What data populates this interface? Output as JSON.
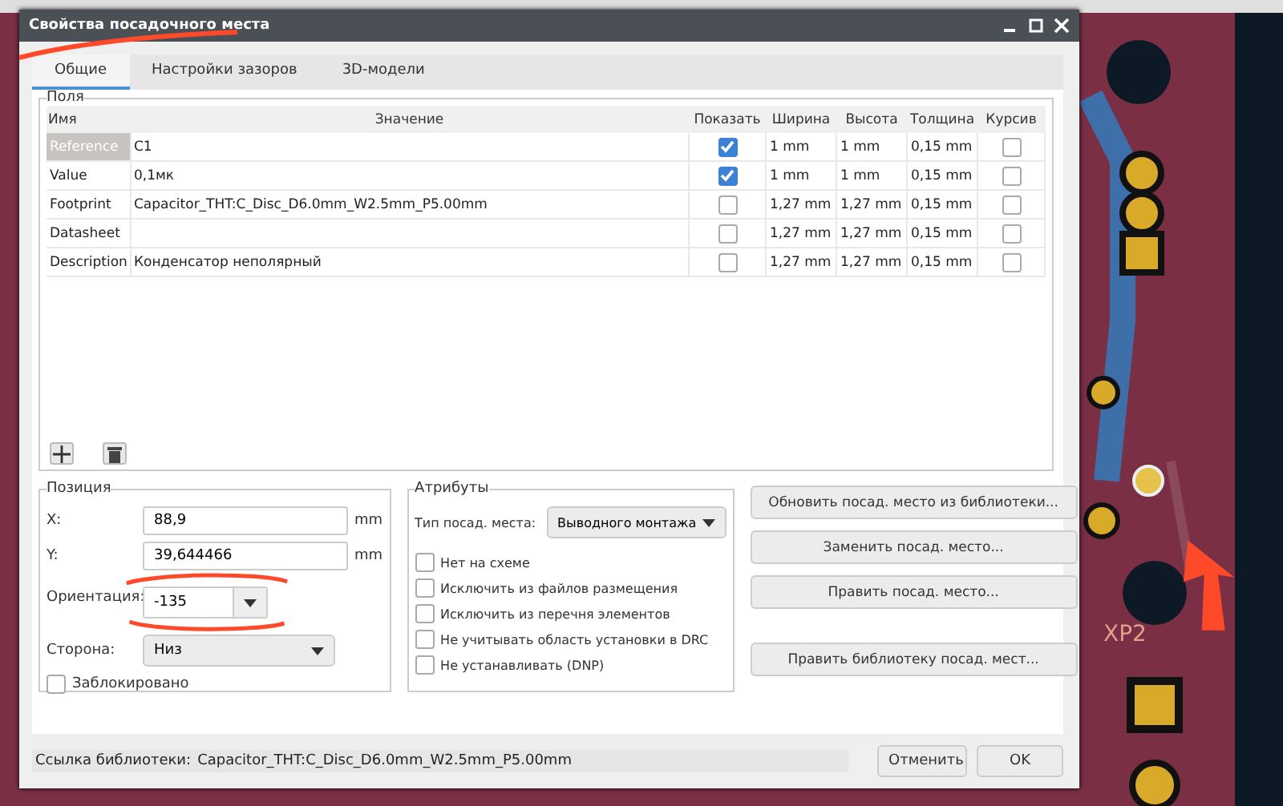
{
  "window": {
    "title": "Свойства посадочного места"
  },
  "tabs": [
    {
      "label": "Общие",
      "selected": true
    },
    {
      "label": "Настройки зазоров",
      "selected": false
    },
    {
      "label": "3D-модели",
      "selected": false
    }
  ],
  "fields": {
    "title": "Поля",
    "columns": [
      "Имя",
      "Значение",
      "Показать",
      "Ширина",
      "Высота",
      "Толщина",
      "Курсив"
    ],
    "rows": [
      {
        "name": "Reference",
        "value": "C1",
        "show": true,
        "width": "1 mm",
        "height": "1 mm",
        "thickness": "0,15 mm",
        "italic": false,
        "selected": true
      },
      {
        "name": "Value",
        "value": "0,1мк",
        "show": true,
        "width": "1 mm",
        "height": "1 mm",
        "thickness": "0,15 mm",
        "italic": false,
        "selected": false
      },
      {
        "name": "Footprint",
        "value": "Capacitor_THT:C_Disc_D6.0mm_W2.5mm_P5.00mm",
        "show": false,
        "width": "1,27 mm",
        "height": "1,27 mm",
        "thickness": "0,15 mm",
        "italic": false,
        "selected": false
      },
      {
        "name": "Datasheet",
        "show": false,
        "width": "1,27 mm",
        "height": "1,27 mm",
        "thickness": "0,15 mm",
        "italic": false,
        "selected": false
      },
      {
        "name": "Description",
        "value": "Конденсатор неполярный",
        "show": false,
        "width": "1,27 mm",
        "height": "1,27 mm",
        "thickness": "0,15 mm",
        "italic": false,
        "selected": false
      }
    ]
  },
  "position": {
    "title": "Позиция",
    "x": {
      "label": "X:",
      "value": "88,9",
      "unit": "mm"
    },
    "y": {
      "label": "Y:",
      "value": "39,644466",
      "unit": "mm"
    },
    "orientation": {
      "label": "Ориентация:",
      "value": "-135"
    },
    "side": {
      "label": "Сторона:",
      "value": "Низ"
    },
    "locked": {
      "label": "Заблокировано",
      "checked": false
    }
  },
  "attributes": {
    "title": "Атрибуты",
    "type_label": "Тип посад. места:",
    "type_value": "Выводного монтажа",
    "options": [
      {
        "label": "Нет на схеме",
        "checked": false
      },
      {
        "label": "Исключить из файлов размещения",
        "checked": false
      },
      {
        "label": "Исключить из перечня элементов",
        "checked": false
      },
      {
        "label": "Не учитывать область установки в DRC",
        "checked": false
      },
      {
        "label": "Не устанавливать (DNP)",
        "checked": false
      }
    ]
  },
  "actions": [
    "Обновить посад. место из библиотеки...",
    "Заменить посад. место...",
    "Править посад. место...",
    "Править библиотеку посад. мест..."
  ],
  "footer": {
    "library_label": "Ссылка библиотеки:",
    "library_value": "Capacitor_THT:C_Disc_D6.0mm_W2.5mm_P5.00mm",
    "buttons": [
      "Отменить",
      "OK"
    ]
  },
  "pcb": {
    "label": "XP2"
  }
}
